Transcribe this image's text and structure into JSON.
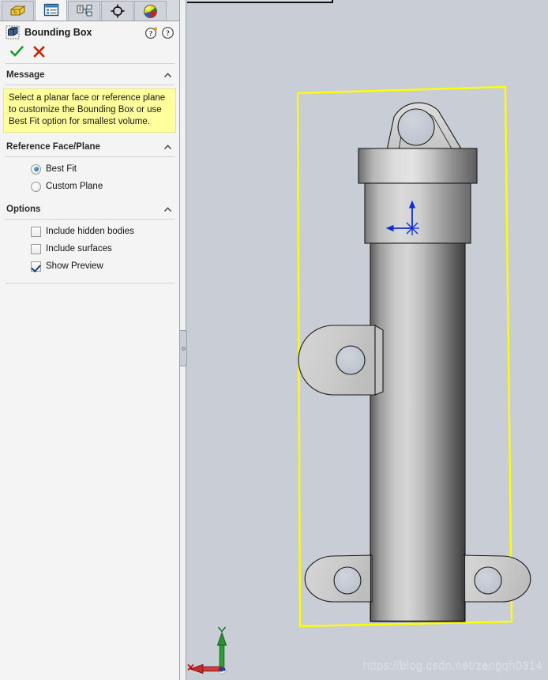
{
  "panel": {
    "tabs": [
      {
        "name": "feature-manager-tab",
        "icon": "yellow-extrude-icon",
        "active": false
      },
      {
        "name": "property-manager-tab",
        "icon": "property-list-icon",
        "active": true
      },
      {
        "name": "configuration-manager-tab",
        "icon": "configuration-icon",
        "active": false
      },
      {
        "name": "dimxpert-manager-tab",
        "icon": "crosshair-target-icon",
        "active": false
      },
      {
        "name": "display-manager-tab",
        "icon": "color-sphere-icon",
        "active": false
      }
    ],
    "title": "Bounding Box",
    "title_icon": "bounding-box-icon",
    "help_whats_new_icon": "help-whats-new-icon",
    "help_icon": "help-icon",
    "ok_label": "OK",
    "cancel_label": "Cancel",
    "sections": {
      "message": {
        "header": "Message",
        "collapse_icon": "chevron-up-icon",
        "text": "Select a planar face or reference plane to customize the Bounding Box or use Best Fit option for smallest volume."
      },
      "reference": {
        "header": "Reference Face/Plane",
        "collapse_icon": "chevron-up-icon",
        "options": [
          {
            "label": "Best Fit",
            "selected": true
          },
          {
            "label": "Custom Plane",
            "selected": false
          }
        ]
      },
      "options": {
        "header": "Options",
        "collapse_icon": "chevron-up-icon",
        "checkboxes": [
          {
            "label": "Include hidden bodies",
            "checked": false
          },
          {
            "label": "Include surfaces",
            "checked": false
          },
          {
            "label": "Show Preview",
            "checked": true
          }
        ]
      }
    }
  },
  "viewport": {
    "model_name": "hydraulic-cylinder-part",
    "preview_box_color": "#ffff00",
    "background_color": "#c8cdd6",
    "origin_marker": "origin-triad-marker",
    "triad": {
      "x_label": "X",
      "y_label": "Y",
      "x_color": "#cc0000",
      "y_color": "#117722"
    },
    "watermark": "https://blog.csdn.net/zengqh0314"
  },
  "colors": {
    "panel_bg": "#f4f4f4",
    "message_bg": "#ffff9b",
    "accent": "#1a74b8",
    "ok_green": "#1f9b28",
    "cancel_red": "#cc2200"
  }
}
